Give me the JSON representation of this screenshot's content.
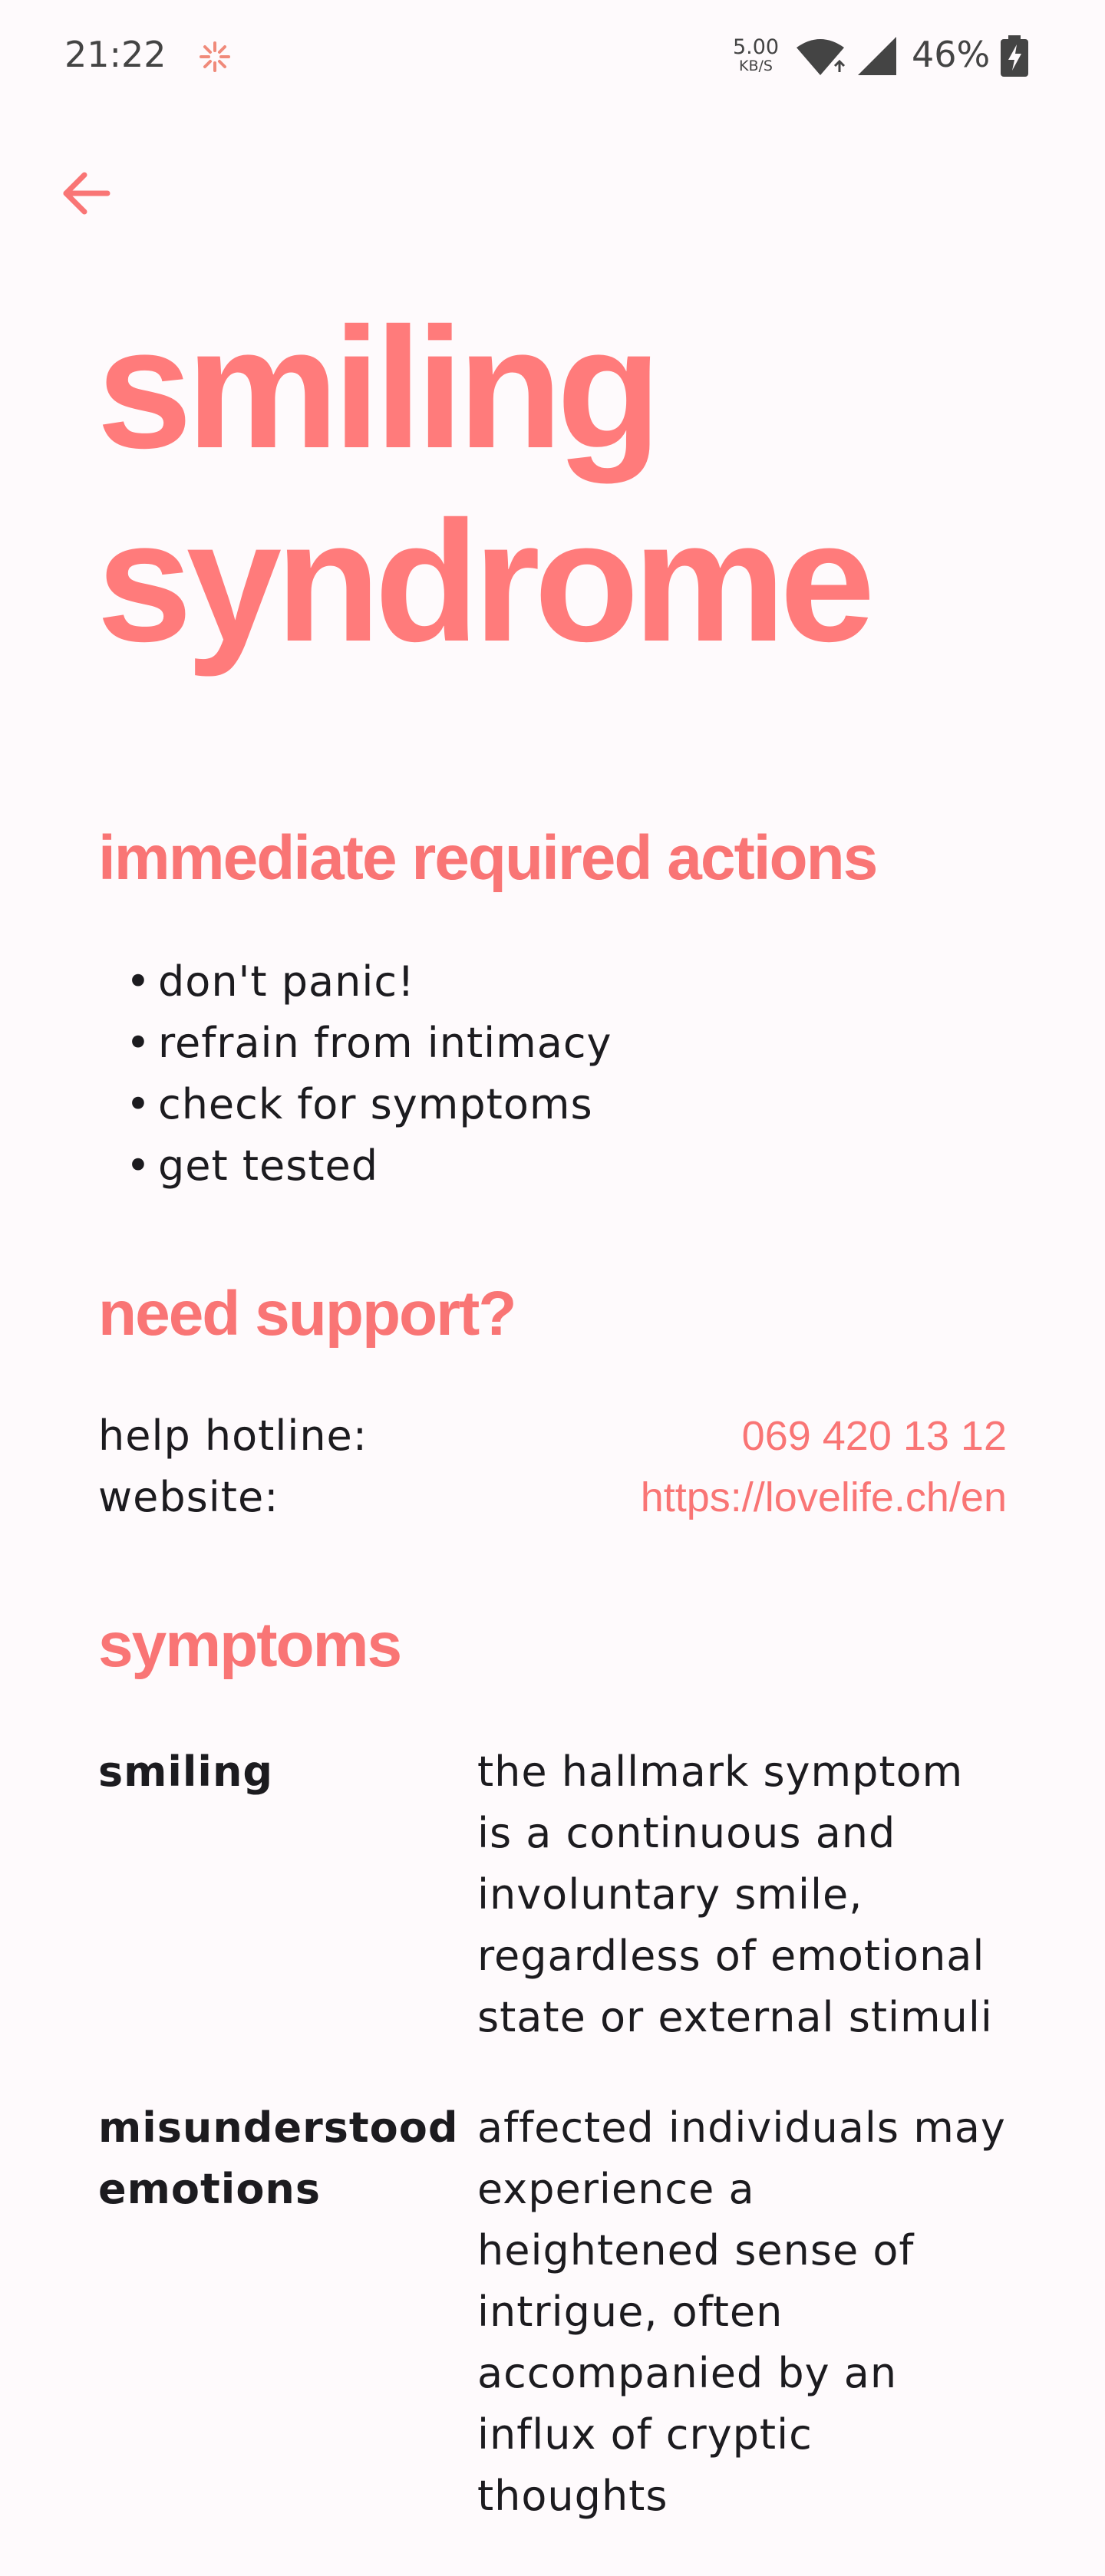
{
  "status_bar": {
    "time": "21:22",
    "net_speed_value": "5.00",
    "net_speed_unit": "KB/S",
    "battery": "46%"
  },
  "header": {
    "back_icon": "arrow-left-icon"
  },
  "title": {
    "line1": "smiling",
    "line2": "syndrome"
  },
  "actions": {
    "heading": "immediate required actions",
    "items": [
      "don't panic!",
      "refrain from intimacy",
      "check for symptoms",
      "get tested"
    ]
  },
  "support": {
    "heading": "need support?",
    "hotline_label": "help hotline:",
    "hotline_value": "069 420 13 12",
    "website_label": "website:",
    "website_value": "https://lovelife.ch/en"
  },
  "symptoms": {
    "heading": "symptoms",
    "items": [
      {
        "name": "smiling",
        "description": "the hallmark symptom is a continuous and involuntary smile, regardless of emotional state or external stimuli"
      },
      {
        "name": "misunderstood emotions",
        "description": "affected individuals may experience a heightened sense of intrigue, often accompanied by an influx of cryptic thoughts"
      }
    ]
  },
  "colors": {
    "accent": "#f97575",
    "title": "#ff7b7b",
    "background": "#fefafc",
    "text": "#1c1b1f"
  }
}
